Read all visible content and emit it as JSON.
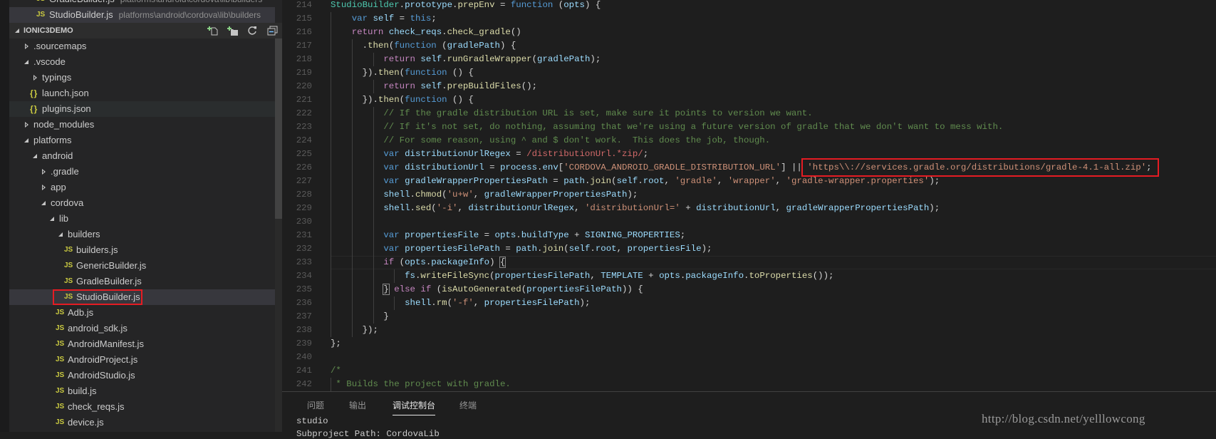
{
  "open_editors": [
    {
      "icon": "js-file-icon",
      "label": "GradleBuilder.js",
      "path": "platforms\\android\\cordova\\lib\\builders",
      "selected": false
    },
    {
      "icon": "js-file-icon",
      "label": "StudioBuilder.js",
      "path": "platforms\\android\\cordova\\lib\\builders",
      "selected": true
    }
  ],
  "explorer": {
    "title": "IONIC3DEMO",
    "actions": [
      {
        "name": "new-file-icon",
        "label": "New File"
      },
      {
        "name": "new-folder-icon",
        "label": "New Folder"
      },
      {
        "name": "refresh-icon",
        "label": "Refresh"
      },
      {
        "name": "collapse-all-icon",
        "label": "Collapse All"
      }
    ],
    "tree": [
      {
        "label": ".sourcemaps",
        "level": 0,
        "kind": "folder",
        "open": false
      },
      {
        "label": ".vscode",
        "level": 0,
        "kind": "folder",
        "open": true
      },
      {
        "label": "typings",
        "level": 1,
        "kind": "folder",
        "open": false
      },
      {
        "label": "launch.json",
        "level": 1,
        "kind": "json"
      },
      {
        "label": "plugins.json",
        "level": 1,
        "kind": "json",
        "state": "hover"
      },
      {
        "label": "node_modules",
        "level": 0,
        "kind": "folder",
        "open": false
      },
      {
        "label": "platforms",
        "level": 0,
        "kind": "folder",
        "open": true
      },
      {
        "label": "android",
        "level": 1,
        "kind": "folder",
        "open": true
      },
      {
        "label": ".gradle",
        "level": 2,
        "kind": "folder",
        "open": false
      },
      {
        "label": "app",
        "level": 2,
        "kind": "folder",
        "open": false
      },
      {
        "label": "cordova",
        "level": 2,
        "kind": "folder",
        "open": true
      },
      {
        "label": "lib",
        "level": 3,
        "kind": "folder",
        "open": true
      },
      {
        "label": "builders",
        "level": 4,
        "kind": "folder",
        "open": true
      },
      {
        "label": "builders.js",
        "level": 5,
        "kind": "js"
      },
      {
        "label": "GenericBuilder.js",
        "level": 5,
        "kind": "js"
      },
      {
        "label": "GradleBuilder.js",
        "level": 5,
        "kind": "js"
      },
      {
        "label": "StudioBuilder.js",
        "level": 5,
        "kind": "js",
        "state": "selected",
        "highlighted": true
      },
      {
        "label": "Adb.js",
        "level": 4,
        "kind": "js"
      },
      {
        "label": "android_sdk.js",
        "level": 4,
        "kind": "js"
      },
      {
        "label": "AndroidManifest.js",
        "level": 4,
        "kind": "js"
      },
      {
        "label": "AndroidProject.js",
        "level": 4,
        "kind": "js"
      },
      {
        "label": "AndroidStudio.js",
        "level": 4,
        "kind": "js"
      },
      {
        "label": "build.js",
        "level": 4,
        "kind": "js"
      },
      {
        "label": "check_reqs.js",
        "level": 4,
        "kind": "js"
      },
      {
        "label": "device.js",
        "level": 4,
        "kind": "js"
      }
    ]
  },
  "editor": {
    "current_line": 233,
    "highlight_color": "#e51c23",
    "lines": [
      {
        "n": 214,
        "t": [
          [
            "c",
            "StudioBuilder"
          ],
          [
            "p",
            "."
          ],
          [
            "v",
            "prototype"
          ],
          [
            "p",
            "."
          ],
          [
            "f",
            "prepEnv"
          ],
          [
            "p",
            " = "
          ],
          [
            "k",
            "function"
          ],
          [
            "p",
            " ("
          ],
          [
            "v",
            "opts"
          ],
          [
            "p",
            ") {"
          ]
        ]
      },
      {
        "n": 215,
        "t": [
          [
            "p",
            "    "
          ],
          [
            "k",
            "var"
          ],
          [
            "p",
            " "
          ],
          [
            "v",
            "self"
          ],
          [
            "p",
            " = "
          ],
          [
            "k",
            "this"
          ],
          [
            "p",
            ";"
          ]
        ]
      },
      {
        "n": 216,
        "t": [
          [
            "p",
            "    "
          ],
          [
            "x",
            "return"
          ],
          [
            "p",
            " "
          ],
          [
            "v",
            "check_reqs"
          ],
          [
            "p",
            "."
          ],
          [
            "f",
            "check_gradle"
          ],
          [
            "p",
            "()"
          ]
        ]
      },
      {
        "n": 217,
        "t": [
          [
            "p",
            "      ."
          ],
          [
            "f",
            "then"
          ],
          [
            "p",
            "("
          ],
          [
            "k",
            "function"
          ],
          [
            "p",
            " ("
          ],
          [
            "v",
            "gradlePath"
          ],
          [
            "p",
            ") {"
          ]
        ]
      },
      {
        "n": 218,
        "t": [
          [
            "p",
            "          "
          ],
          [
            "x",
            "return"
          ],
          [
            "p",
            " "
          ],
          [
            "v",
            "self"
          ],
          [
            "p",
            "."
          ],
          [
            "f",
            "runGradleWrapper"
          ],
          [
            "p",
            "("
          ],
          [
            "v",
            "gradlePath"
          ],
          [
            "p",
            ");"
          ]
        ]
      },
      {
        "n": 219,
        "t": [
          [
            "p",
            "      })."
          ],
          [
            "f",
            "then"
          ],
          [
            "p",
            "("
          ],
          [
            "k",
            "function"
          ],
          [
            "p",
            " () {"
          ]
        ]
      },
      {
        "n": 220,
        "t": [
          [
            "p",
            "          "
          ],
          [
            "x",
            "return"
          ],
          [
            "p",
            " "
          ],
          [
            "v",
            "self"
          ],
          [
            "p",
            "."
          ],
          [
            "f",
            "prepBuildFiles"
          ],
          [
            "p",
            "();"
          ]
        ]
      },
      {
        "n": 221,
        "t": [
          [
            "p",
            "      })."
          ],
          [
            "f",
            "then"
          ],
          [
            "p",
            "("
          ],
          [
            "k",
            "function"
          ],
          [
            "p",
            " () {"
          ]
        ]
      },
      {
        "n": 222,
        "t": [
          [
            "p",
            "          "
          ],
          [
            "m",
            "// If the gradle distribution URL is set, make sure it points to version we want."
          ]
        ]
      },
      {
        "n": 223,
        "t": [
          [
            "p",
            "          "
          ],
          [
            "m",
            "// If it's not set, do nothing, assuming that we're using a future version of gradle that we don't want to mess with."
          ]
        ]
      },
      {
        "n": 224,
        "t": [
          [
            "p",
            "          "
          ],
          [
            "m",
            "// For some reason, using ^ and $ don't work.  This does the job, though."
          ]
        ]
      },
      {
        "n": 225,
        "t": [
          [
            "p",
            "          "
          ],
          [
            "k",
            "var"
          ],
          [
            "p",
            " "
          ],
          [
            "v",
            "distributionUrlRegex"
          ],
          [
            "p",
            " = "
          ],
          [
            "r",
            "/distributionUrl.*zip/"
          ],
          [
            "p",
            ";"
          ]
        ]
      },
      {
        "n": 226,
        "t": [
          [
            "p",
            "          "
          ],
          [
            "k",
            "var"
          ],
          [
            "p",
            " "
          ],
          [
            "v",
            "distributionUrl"
          ],
          [
            "p",
            " = "
          ],
          [
            "v",
            "process"
          ],
          [
            "p",
            "."
          ],
          [
            "v",
            "env"
          ],
          [
            "p",
            "["
          ],
          [
            "s",
            "'CORDOVA_ANDROID_GRADLE_DISTRIBUTION_URL'"
          ],
          [
            "p",
            "] || "
          ],
          [
            "s",
            "'https\\\\://services.gradle.org/distributions/gradle-4.1-all.zip'",
            "boxed"
          ],
          [
            "p",
            ";"
          ]
        ]
      },
      {
        "n": 227,
        "t": [
          [
            "p",
            "          "
          ],
          [
            "k",
            "var"
          ],
          [
            "p",
            " "
          ],
          [
            "v",
            "gradleWrapperPropertiesPath"
          ],
          [
            "p",
            " = "
          ],
          [
            "v",
            "path"
          ],
          [
            "p",
            "."
          ],
          [
            "f",
            "join"
          ],
          [
            "p",
            "("
          ],
          [
            "v",
            "self"
          ],
          [
            "p",
            "."
          ],
          [
            "v",
            "root"
          ],
          [
            "p",
            ", "
          ],
          [
            "s",
            "'gradle'"
          ],
          [
            "p",
            ", "
          ],
          [
            "s",
            "'wrapper'"
          ],
          [
            "p",
            ", "
          ],
          [
            "s",
            "'gradle-wrapper.properties'"
          ],
          [
            "p",
            ");"
          ]
        ]
      },
      {
        "n": 228,
        "t": [
          [
            "p",
            "          "
          ],
          [
            "v",
            "shell"
          ],
          [
            "p",
            "."
          ],
          [
            "f",
            "chmod"
          ],
          [
            "p",
            "("
          ],
          [
            "s",
            "'u+w'"
          ],
          [
            "p",
            ", "
          ],
          [
            "v",
            "gradleWrapperPropertiesPath"
          ],
          [
            "p",
            ");"
          ]
        ]
      },
      {
        "n": 229,
        "t": [
          [
            "p",
            "          "
          ],
          [
            "v",
            "shell"
          ],
          [
            "p",
            "."
          ],
          [
            "f",
            "sed"
          ],
          [
            "p",
            "("
          ],
          [
            "s",
            "'-i'"
          ],
          [
            "p",
            ", "
          ],
          [
            "v",
            "distributionUrlRegex"
          ],
          [
            "p",
            ", "
          ],
          [
            "s",
            "'distributionUrl='"
          ],
          [
            "p",
            " + "
          ],
          [
            "v",
            "distributionUrl"
          ],
          [
            "p",
            ", "
          ],
          [
            "v",
            "gradleWrapperPropertiesPath"
          ],
          [
            "p",
            ");"
          ]
        ]
      },
      {
        "n": 230,
        "t": []
      },
      {
        "n": 231,
        "t": [
          [
            "p",
            "          "
          ],
          [
            "k",
            "var"
          ],
          [
            "p",
            " "
          ],
          [
            "v",
            "propertiesFile"
          ],
          [
            "p",
            " = "
          ],
          [
            "v",
            "opts"
          ],
          [
            "p",
            "."
          ],
          [
            "v",
            "buildType"
          ],
          [
            "p",
            " + "
          ],
          [
            "v",
            "SIGNING_PROPERTIES"
          ],
          [
            "p",
            ";"
          ]
        ]
      },
      {
        "n": 232,
        "t": [
          [
            "p",
            "          "
          ],
          [
            "k",
            "var"
          ],
          [
            "p",
            " "
          ],
          [
            "v",
            "propertiesFilePath"
          ],
          [
            "p",
            " = "
          ],
          [
            "v",
            "path"
          ],
          [
            "p",
            "."
          ],
          [
            "f",
            "join"
          ],
          [
            "p",
            "("
          ],
          [
            "v",
            "self"
          ],
          [
            "p",
            "."
          ],
          [
            "v",
            "root"
          ],
          [
            "p",
            ", "
          ],
          [
            "v",
            "propertiesFile"
          ],
          [
            "p",
            ");"
          ]
        ]
      },
      {
        "n": 233,
        "t": [
          [
            "p",
            "          "
          ],
          [
            "x",
            "if"
          ],
          [
            "p",
            " ("
          ],
          [
            "v",
            "opts"
          ],
          [
            "p",
            "."
          ],
          [
            "v",
            "packageInfo"
          ],
          [
            "p",
            ") "
          ],
          [
            "p",
            "{",
            "brk"
          ]
        ]
      },
      {
        "n": 234,
        "t": [
          [
            "p",
            "              "
          ],
          [
            "v",
            "fs"
          ],
          [
            "p",
            "."
          ],
          [
            "f",
            "writeFileSync"
          ],
          [
            "p",
            "("
          ],
          [
            "v",
            "propertiesFilePath"
          ],
          [
            "p",
            ", "
          ],
          [
            "v",
            "TEMPLATE"
          ],
          [
            "p",
            " + "
          ],
          [
            "v",
            "opts"
          ],
          [
            "p",
            "."
          ],
          [
            "v",
            "packageInfo"
          ],
          [
            "p",
            "."
          ],
          [
            "f",
            "toProperties"
          ],
          [
            "p",
            "());"
          ]
        ]
      },
      {
        "n": 235,
        "t": [
          [
            "p",
            "          "
          ],
          [
            "p",
            "}",
            "brk"
          ],
          [
            "p",
            " "
          ],
          [
            "x",
            "else"
          ],
          [
            "p",
            " "
          ],
          [
            "x",
            "if"
          ],
          [
            "p",
            " ("
          ],
          [
            "f",
            "isAutoGenerated"
          ],
          [
            "p",
            "("
          ],
          [
            "v",
            "propertiesFilePath"
          ],
          [
            "p",
            ")) {"
          ]
        ]
      },
      {
        "n": 236,
        "t": [
          [
            "p",
            "              "
          ],
          [
            "v",
            "shell"
          ],
          [
            "p",
            "."
          ],
          [
            "f",
            "rm"
          ],
          [
            "p",
            "("
          ],
          [
            "s",
            "'-f'"
          ],
          [
            "p",
            ", "
          ],
          [
            "v",
            "propertiesFilePath"
          ],
          [
            "p",
            ");"
          ]
        ]
      },
      {
        "n": 237,
        "t": [
          [
            "p",
            "          }"
          ]
        ]
      },
      {
        "n": 238,
        "t": [
          [
            "p",
            "      });"
          ]
        ]
      },
      {
        "n": 239,
        "t": [
          [
            "p",
            "};"
          ]
        ]
      },
      {
        "n": 240,
        "t": []
      },
      {
        "n": 241,
        "t": [
          [
            "m",
            "/*"
          ]
        ]
      },
      {
        "n": 242,
        "t": [
          [
            "m",
            " * Builds the project with gradle."
          ]
        ]
      }
    ]
  },
  "panel": {
    "tabs": [
      {
        "label": "问题",
        "active": false
      },
      {
        "label": "输出",
        "active": false
      },
      {
        "label": "调试控制台",
        "active": true
      },
      {
        "label": "终端",
        "active": false
      }
    ],
    "output": [
      "studio",
      "Subproject Path: CordovaLib"
    ]
  },
  "watermark": "http://blog.csdn.net/yelllowcong"
}
